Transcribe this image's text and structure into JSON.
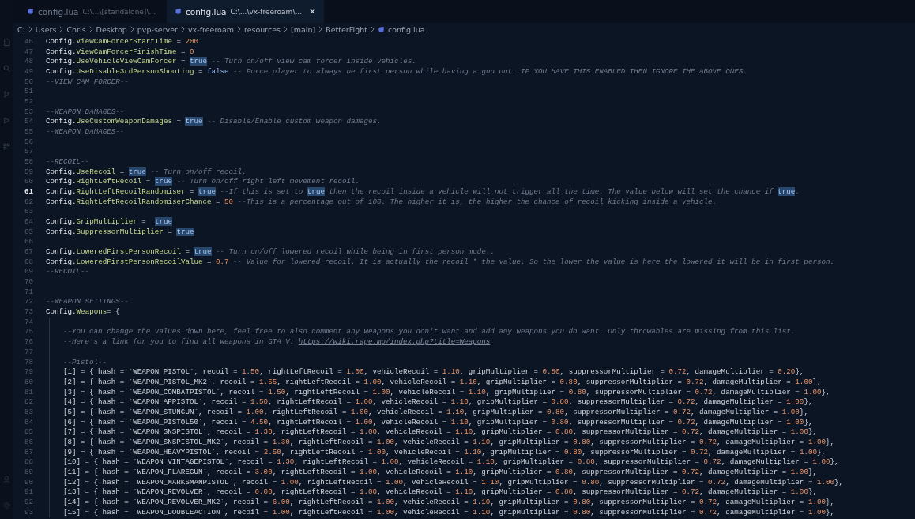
{
  "tabs": [
    {
      "name": "config.lua",
      "path": "C:\\...\\[standalone]\\...",
      "selected": false
    },
    {
      "name": "config.lua",
      "path": "C:\\...\\vx-freeroam\\...",
      "selected": true
    }
  ],
  "breadcrumb": [
    "C:",
    "Users",
    "Chris",
    "Desktop",
    "pvp-server",
    "vx-freeroam",
    "resources",
    "[main]",
    "BetterFight",
    "config.lua"
  ],
  "lines": [
    {
      "number": "46",
      "active": false,
      "tokens": [
        {
          "kind": "kw",
          "text": "Config."
        },
        {
          "kind": "prop",
          "text": "ViewCamForcerStartTime"
        },
        {
          "kind": "op",
          "text": " = "
        },
        {
          "kind": "num",
          "text": "200"
        }
      ]
    },
    {
      "number": "47",
      "active": false,
      "tokens": [
        {
          "kind": "kw",
          "text": "Config."
        },
        {
          "kind": "prop",
          "text": "ViewCamForcerFinishTime"
        },
        {
          "kind": "op",
          "text": " = "
        },
        {
          "kind": "num",
          "text": "0"
        }
      ]
    },
    {
      "number": "48",
      "active": false,
      "tokens": [
        {
          "kind": "kw",
          "text": "Config."
        },
        {
          "kind": "prop",
          "text": "UseVehicleViewCamForcer"
        },
        {
          "kind": "op",
          "text": " = "
        },
        {
          "kind": "match",
          "text": "true"
        },
        {
          "kind": "comment",
          "text": " -- Turn on/off view cam forcer inside vehicles."
        }
      ]
    },
    {
      "number": "49",
      "active": false,
      "tokens": [
        {
          "kind": "kw",
          "text": "Config."
        },
        {
          "kind": "prop",
          "text": "UseDisable3rdPersonShooting"
        },
        {
          "kind": "op",
          "text": " = "
        },
        {
          "kind": "bool",
          "text": "false"
        },
        {
          "kind": "comment",
          "text": " -- Force player to always be first person while having a gun out. IF YOU HAVE THIS ENABLED THEN IGNORE THE ABOVE ONES."
        }
      ]
    },
    {
      "number": "50",
      "active": false,
      "tokens": [
        {
          "kind": "comment",
          "text": "--VIEW CAM FORCER--"
        }
      ]
    },
    {
      "number": "51",
      "active": false
    },
    {
      "number": "52",
      "active": false
    },
    {
      "number": "53",
      "active": false,
      "tokens": [
        {
          "kind": "comment",
          "text": "--WEAPON DAMAGES--"
        }
      ]
    },
    {
      "number": "54",
      "active": false,
      "tokens": [
        {
          "kind": "kw",
          "text": "Config."
        },
        {
          "kind": "prop",
          "text": "UseCustomWeaponDamages"
        },
        {
          "kind": "op",
          "text": " = "
        },
        {
          "kind": "match",
          "text": "true"
        },
        {
          "kind": "comment",
          "text": " -- Disable/Enable custom weapon damages."
        }
      ]
    },
    {
      "number": "55",
      "active": false,
      "tokens": [
        {
          "kind": "comment",
          "text": "--WEAPON DAMAGES--"
        }
      ]
    },
    {
      "number": "56",
      "active": false
    },
    {
      "number": "57",
      "active": false
    },
    {
      "number": "58",
      "active": false,
      "tokens": [
        {
          "kind": "comment",
          "text": "--RECOIL--"
        }
      ]
    },
    {
      "number": "59",
      "active": false,
      "tokens": [
        {
          "kind": "kw",
          "text": "Config."
        },
        {
          "kind": "prop",
          "text": "UseRecoil"
        },
        {
          "kind": "op",
          "text": " = "
        },
        {
          "kind": "match",
          "text": "true"
        },
        {
          "kind": "comment",
          "text": " -- Turn on/off recoil."
        }
      ]
    },
    {
      "number": "60",
      "active": false,
      "tokens": [
        {
          "kind": "kw",
          "text": "Config."
        },
        {
          "kind": "prop",
          "text": "RightLeftRecoil"
        },
        {
          "kind": "op",
          "text": " = "
        },
        {
          "kind": "match",
          "text": "true"
        },
        {
          "kind": "comment",
          "text": " -- Turn on/off right left movement recoil."
        }
      ]
    },
    {
      "number": "61",
      "active": true,
      "tokens": [
        {
          "kind": "kw",
          "text": "Config."
        },
        {
          "kind": "prop",
          "text": "RightLeftRecoilRandomiser"
        },
        {
          "kind": "op",
          "text": " = "
        },
        {
          "kind": "match",
          "text": "true"
        },
        {
          "kind": "comment",
          "text": " --If this is set to "
        },
        {
          "kind": "match",
          "text": "true"
        },
        {
          "kind": "comment",
          "text": " then the recoil inside a vehicle will not trigger all the time. The value below will set the chance if "
        },
        {
          "kind": "match",
          "text": "true"
        },
        {
          "kind": "comment",
          "text": "."
        }
      ]
    },
    {
      "number": "62",
      "active": false,
      "tokens": [
        {
          "kind": "kw",
          "text": "Config."
        },
        {
          "kind": "prop",
          "text": "RightLeftRecoilRandomiserChance"
        },
        {
          "kind": "op",
          "text": " = "
        },
        {
          "kind": "num",
          "text": "50"
        },
        {
          "kind": "comment",
          "text": " --This is a percentage out of 100. The higher it is, the higher the chance of recoil kicking inside a vehicle."
        }
      ]
    },
    {
      "number": "63",
      "active": false
    },
    {
      "number": "64",
      "active": false,
      "tokens": [
        {
          "kind": "kw",
          "text": "Config."
        },
        {
          "kind": "prop",
          "text": "GripMultiplier"
        },
        {
          "kind": "op",
          "text": " =  "
        },
        {
          "kind": "match",
          "text": "true"
        }
      ]
    },
    {
      "number": "65",
      "active": false,
      "tokens": [
        {
          "kind": "kw",
          "text": "Config."
        },
        {
          "kind": "prop",
          "text": "SuppressorMultiplier"
        },
        {
          "kind": "op",
          "text": " = "
        },
        {
          "kind": "match",
          "text": "true"
        }
      ]
    },
    {
      "number": "66",
      "active": false
    },
    {
      "number": "67",
      "active": false,
      "tokens": [
        {
          "kind": "kw",
          "text": "Config."
        },
        {
          "kind": "prop",
          "text": "LoweredFirstPersonRecoil"
        },
        {
          "kind": "op",
          "text": " = "
        },
        {
          "kind": "match",
          "text": "true"
        },
        {
          "kind": "comment",
          "text": " -- Turn on/off lowered recoil while being in first person mode.."
        }
      ]
    },
    {
      "number": "68",
      "active": false,
      "tokens": [
        {
          "kind": "kw",
          "text": "Config."
        },
        {
          "kind": "prop",
          "text": "LoweredFirstPersonRecoilValue"
        },
        {
          "kind": "op",
          "text": " = "
        },
        {
          "kind": "num",
          "text": "0.7"
        },
        {
          "kind": "comment",
          "text": " -- Value for lowered recoil. It is actually the recoil * the value. So the lower the value is here the lowered it will be in first person."
        }
      ]
    },
    {
      "number": "69",
      "active": false,
      "tokens": [
        {
          "kind": "comment",
          "text": "--RECOIL--"
        }
      ]
    },
    {
      "number": "70",
      "active": false
    },
    {
      "number": "71",
      "active": false
    },
    {
      "number": "72",
      "active": false,
      "tokens": [
        {
          "kind": "comment",
          "text": "--WEAPON SETTINGS--"
        }
      ]
    },
    {
      "number": "73",
      "active": false,
      "tokens": [
        {
          "kind": "kw",
          "text": "Config."
        },
        {
          "kind": "prop",
          "text": "Weapons"
        },
        {
          "kind": "op",
          "text": "= {"
        }
      ],
      "children": [
        {
          "number": "74",
          "active": false
        },
        {
          "number": "75",
          "active": false,
          "tokens": [
            {
              "kind": "comment",
              "text": "--You can change the values down here, feel free to also comment any weapons you don't want and add any weapons you do want. Only throwables are missing from this list."
            }
          ]
        },
        {
          "number": "76",
          "active": false,
          "tokens": [
            {
              "kind": "comment",
              "text": "--Here's a link for you to find all weapons in GTA V: "
            },
            {
              "kind": "link",
              "text": "https://wiki.rage.mp/index.php?title=Weapons"
            }
          ]
        },
        {
          "number": "77",
          "active": false
        },
        {
          "number": "78",
          "active": false,
          "tokens": [
            {
              "kind": "comment",
              "text": "--Pistol--"
            }
          ]
        },
        {
          "number": "79",
          "active": false,
          "tokens": [
            {
              "kind": "op",
              "text": "[1] = { hash = `WEAPON_PISTOL`, recoil = "
            },
            {
              "kind": "num",
              "text": "1.50"
            },
            {
              "kind": "op",
              "text": ", rightLeftRecoil = "
            },
            {
              "kind": "num",
              "text": "1.00"
            },
            {
              "kind": "op",
              "text": ", vehicleRecoil = "
            },
            {
              "kind": "num",
              "text": "1.10"
            },
            {
              "kind": "op",
              "text": ", gripMultiplier = "
            },
            {
              "kind": "num",
              "text": "0.80"
            },
            {
              "kind": "op",
              "text": ", suppressorMultiplier = "
            },
            {
              "kind": "num",
              "text": "0.72"
            },
            {
              "kind": "op",
              "text": ", damageMultiplier = "
            },
            {
              "kind": "num",
              "text": "0.20"
            },
            {
              "kind": "op",
              "text": "},"
            }
          ]
        },
        {
          "number": "80",
          "active": false,
          "tokens": [
            {
              "kind": "op",
              "text": "[2] = { hash = `WEAPON_PISTOL_MK2`, recoil = "
            },
            {
              "kind": "num",
              "text": "1.55"
            },
            {
              "kind": "op",
              "text": ", rightLeftRecoil = "
            },
            {
              "kind": "num",
              "text": "1.00"
            },
            {
              "kind": "op",
              "text": ", vehicleRecoil = "
            },
            {
              "kind": "num",
              "text": "1.10"
            },
            {
              "kind": "op",
              "text": ", gripMultiplier = "
            },
            {
              "kind": "num",
              "text": "0.80"
            },
            {
              "kind": "op",
              "text": ", suppressorMultiplier = "
            },
            {
              "kind": "num",
              "text": "0.72"
            },
            {
              "kind": "op",
              "text": ", damageMultiplier = "
            },
            {
              "kind": "num",
              "text": "1.00"
            },
            {
              "kind": "op",
              "text": "},"
            }
          ]
        },
        {
          "number": "81",
          "active": false,
          "tokens": [
            {
              "kind": "op",
              "text": "[3] = { hash = `WEAPON_COMBATPISTOL`, recoil = "
            },
            {
              "kind": "num",
              "text": "1.50"
            },
            {
              "kind": "op",
              "text": ", rightLeftRecoil = "
            },
            {
              "kind": "num",
              "text": "1.00"
            },
            {
              "kind": "op",
              "text": ", vehicleRecoil = "
            },
            {
              "kind": "num",
              "text": "1.10"
            },
            {
              "kind": "op",
              "text": ", gripMultiplier = "
            },
            {
              "kind": "num",
              "text": "0.80"
            },
            {
              "kind": "op",
              "text": ", suppressorMultiplier = "
            },
            {
              "kind": "num",
              "text": "0.72"
            },
            {
              "kind": "op",
              "text": ", damageMultiplier = "
            },
            {
              "kind": "num",
              "text": "1.00"
            },
            {
              "kind": "op",
              "text": "},"
            }
          ]
        },
        {
          "number": "82",
          "active": false,
          "tokens": [
            {
              "kind": "op",
              "text": "[4] = { hash = `WEAPON_APPISTOL`, recoil = "
            },
            {
              "kind": "num",
              "text": "1.50"
            },
            {
              "kind": "op",
              "text": ", rightLeftRecoil = "
            },
            {
              "kind": "num",
              "text": "1.00"
            },
            {
              "kind": "op",
              "text": ", vehicleRecoil = "
            },
            {
              "kind": "num",
              "text": "1.10"
            },
            {
              "kind": "op",
              "text": ", gripMultiplier = "
            },
            {
              "kind": "num",
              "text": "0.80"
            },
            {
              "kind": "op",
              "text": ", suppressorMultiplier = "
            },
            {
              "kind": "num",
              "text": "0.72"
            },
            {
              "kind": "op",
              "text": ", damageMultiplier = "
            },
            {
              "kind": "num",
              "text": "1.00"
            },
            {
              "kind": "op",
              "text": "},"
            }
          ]
        },
        {
          "number": "83",
          "active": false,
          "tokens": [
            {
              "kind": "op",
              "text": "[5] = { hash = `WEAPON_STUNGUN`, recoil = "
            },
            {
              "kind": "num",
              "text": "1.00"
            },
            {
              "kind": "op",
              "text": ", rightLeftRecoil = "
            },
            {
              "kind": "num",
              "text": "1.00"
            },
            {
              "kind": "op",
              "text": ", vehicleRecoil = "
            },
            {
              "kind": "num",
              "text": "1.10"
            },
            {
              "kind": "op",
              "text": ", gripMultiplier = "
            },
            {
              "kind": "num",
              "text": "0.80"
            },
            {
              "kind": "op",
              "text": ", suppressorMultiplier = "
            },
            {
              "kind": "num",
              "text": "0.72"
            },
            {
              "kind": "op",
              "text": ", damageMultiplier = "
            },
            {
              "kind": "num",
              "text": "1.00"
            },
            {
              "kind": "op",
              "text": "},"
            }
          ]
        },
        {
          "number": "84",
          "active": false,
          "tokens": [
            {
              "kind": "op",
              "text": "[6] = { hash = `WEAPON_PISTOL50`, recoil = "
            },
            {
              "kind": "num",
              "text": "4.50"
            },
            {
              "kind": "op",
              "text": ", rightLeftRecoil = "
            },
            {
              "kind": "num",
              "text": "1.00"
            },
            {
              "kind": "op",
              "text": ", vehicleRecoil = "
            },
            {
              "kind": "num",
              "text": "1.10"
            },
            {
              "kind": "op",
              "text": ", gripMultiplier = "
            },
            {
              "kind": "num",
              "text": "0.80"
            },
            {
              "kind": "op",
              "text": ", suppressorMultiplier = "
            },
            {
              "kind": "num",
              "text": "0.72"
            },
            {
              "kind": "op",
              "text": ", damageMultiplier = "
            },
            {
              "kind": "num",
              "text": "1.00"
            },
            {
              "kind": "op",
              "text": "},"
            }
          ]
        },
        {
          "number": "85",
          "active": false,
          "tokens": [
            {
              "kind": "op",
              "text": "[7] = { hash = `WEAPON_SNSPISTOL`, recoil = "
            },
            {
              "kind": "num",
              "text": "1.30"
            },
            {
              "kind": "op",
              "text": ", rightLeftRecoil = "
            },
            {
              "kind": "num",
              "text": "1.00"
            },
            {
              "kind": "op",
              "text": ", vehicleRecoil = "
            },
            {
              "kind": "num",
              "text": "1.10"
            },
            {
              "kind": "op",
              "text": ", gripMultiplier = "
            },
            {
              "kind": "num",
              "text": "0.80"
            },
            {
              "kind": "op",
              "text": ", suppressorMultiplier = "
            },
            {
              "kind": "num",
              "text": "0.72"
            },
            {
              "kind": "op",
              "text": ", damageMultiplier = "
            },
            {
              "kind": "num",
              "text": "1.00"
            },
            {
              "kind": "op",
              "text": "},"
            }
          ]
        },
        {
          "number": "86",
          "active": false,
          "tokens": [
            {
              "kind": "op",
              "text": "[8] = { hash = `WEAPON_SNSPISTOL_MK2`, recoil = "
            },
            {
              "kind": "num",
              "text": "1.30"
            },
            {
              "kind": "op",
              "text": ", rightLeftRecoil = "
            },
            {
              "kind": "num",
              "text": "1.00"
            },
            {
              "kind": "op",
              "text": ", vehicleRecoil = "
            },
            {
              "kind": "num",
              "text": "1.10"
            },
            {
              "kind": "op",
              "text": ", gripMultiplier = "
            },
            {
              "kind": "num",
              "text": "0.80"
            },
            {
              "kind": "op",
              "text": ", suppressorMultiplier = "
            },
            {
              "kind": "num",
              "text": "0.72"
            },
            {
              "kind": "op",
              "text": ", damageMultiplier = "
            },
            {
              "kind": "num",
              "text": "1.00"
            },
            {
              "kind": "op",
              "text": "},"
            }
          ]
        },
        {
          "number": "87",
          "active": false,
          "tokens": [
            {
              "kind": "op",
              "text": "[9] = { hash = `WEAPON_HEAVYPISTOL`, recoil = "
            },
            {
              "kind": "num",
              "text": "2.50"
            },
            {
              "kind": "op",
              "text": ", rightLeftRecoil = "
            },
            {
              "kind": "num",
              "text": "1.00"
            },
            {
              "kind": "op",
              "text": ", vehicleRecoil = "
            },
            {
              "kind": "num",
              "text": "1.10"
            },
            {
              "kind": "op",
              "text": ", gripMultiplier = "
            },
            {
              "kind": "num",
              "text": "0.80"
            },
            {
              "kind": "op",
              "text": ", suppressorMultiplier = "
            },
            {
              "kind": "num",
              "text": "0.72"
            },
            {
              "kind": "op",
              "text": ", damageMultiplier = "
            },
            {
              "kind": "num",
              "text": "1.00"
            },
            {
              "kind": "op",
              "text": "},"
            }
          ]
        },
        {
          "number": "88",
          "active": false,
          "tokens": [
            {
              "kind": "op",
              "text": "[10] = { hash = `WEAPON_VINTAGEPISTOL`, recoil = "
            },
            {
              "kind": "num",
              "text": "1.30"
            },
            {
              "kind": "op",
              "text": ", rightLeftRecoil = "
            },
            {
              "kind": "num",
              "text": "1.00"
            },
            {
              "kind": "op",
              "text": ", vehicleRecoil = "
            },
            {
              "kind": "num",
              "text": "1.10"
            },
            {
              "kind": "op",
              "text": ", gripMultiplier = "
            },
            {
              "kind": "num",
              "text": "0.80"
            },
            {
              "kind": "op",
              "text": ", suppressorMultiplier = "
            },
            {
              "kind": "num",
              "text": "0.72"
            },
            {
              "kind": "op",
              "text": ", damageMultiplier = "
            },
            {
              "kind": "num",
              "text": "1.00"
            },
            {
              "kind": "op",
              "text": "},"
            }
          ]
        },
        {
          "number": "89",
          "active": false,
          "tokens": [
            {
              "kind": "op",
              "text": "[11] = { hash = `WEAPON_FLAREGUN`, recoil = "
            },
            {
              "kind": "num",
              "text": "3.00"
            },
            {
              "kind": "op",
              "text": ", rightLeftRecoil = "
            },
            {
              "kind": "num",
              "text": "1.00"
            },
            {
              "kind": "op",
              "text": ", vehicleRecoil = "
            },
            {
              "kind": "num",
              "text": "1.10"
            },
            {
              "kind": "op",
              "text": ", gripMultiplier = "
            },
            {
              "kind": "num",
              "text": "0.80"
            },
            {
              "kind": "op",
              "text": ", suppressorMultiplier = "
            },
            {
              "kind": "num",
              "text": "0.72"
            },
            {
              "kind": "op",
              "text": ", damageMultiplier = "
            },
            {
              "kind": "num",
              "text": "1.00"
            },
            {
              "kind": "op",
              "text": "},"
            }
          ]
        },
        {
          "number": "90",
          "active": false,
          "tokens": [
            {
              "kind": "op",
              "text": "[12] = { hash = `WEAPON_MARKSMANPISTOL`, recoil = "
            },
            {
              "kind": "num",
              "text": "1.00"
            },
            {
              "kind": "op",
              "text": ", rightLeftRecoil = "
            },
            {
              "kind": "num",
              "text": "1.00"
            },
            {
              "kind": "op",
              "text": ", vehicleRecoil = "
            },
            {
              "kind": "num",
              "text": "1.10"
            },
            {
              "kind": "op",
              "text": ", gripMultiplier = "
            },
            {
              "kind": "num",
              "text": "0.80"
            },
            {
              "kind": "op",
              "text": ", suppressorMultiplier = "
            },
            {
              "kind": "num",
              "text": "0.72"
            },
            {
              "kind": "op",
              "text": ", damageMultiplier = "
            },
            {
              "kind": "num",
              "text": "1.00"
            },
            {
              "kind": "op",
              "text": "},"
            }
          ]
        },
        {
          "number": "91",
          "active": false,
          "tokens": [
            {
              "kind": "op",
              "text": "[13] = { hash = `WEAPON_REVOLVER`, recoil = "
            },
            {
              "kind": "num",
              "text": "6.00"
            },
            {
              "kind": "op",
              "text": ", rightLeftRecoil = "
            },
            {
              "kind": "num",
              "text": "1.00"
            },
            {
              "kind": "op",
              "text": ", vehicleRecoil = "
            },
            {
              "kind": "num",
              "text": "1.10"
            },
            {
              "kind": "op",
              "text": ", gripMultiplier = "
            },
            {
              "kind": "num",
              "text": "0.80"
            },
            {
              "kind": "op",
              "text": ", suppressorMultiplier = "
            },
            {
              "kind": "num",
              "text": "0.72"
            },
            {
              "kind": "op",
              "text": ", damageMultiplier = "
            },
            {
              "kind": "num",
              "text": "1.00"
            },
            {
              "kind": "op",
              "text": "},"
            }
          ]
        },
        {
          "number": "92",
          "active": false,
          "tokens": [
            {
              "kind": "op",
              "text": "[14] = { hash = `WEAPON_REVOLVER_MK2`, recoil = "
            },
            {
              "kind": "num",
              "text": "6.00"
            },
            {
              "kind": "op",
              "text": ", rightLeftRecoil = "
            },
            {
              "kind": "num",
              "text": "1.00"
            },
            {
              "kind": "op",
              "text": ", vehicleRecoil = "
            },
            {
              "kind": "num",
              "text": "1.10"
            },
            {
              "kind": "op",
              "text": ", gripMultiplier = "
            },
            {
              "kind": "num",
              "text": "0.80"
            },
            {
              "kind": "op",
              "text": ", suppressorMultiplier = "
            },
            {
              "kind": "num",
              "text": "0.72"
            },
            {
              "kind": "op",
              "text": ", damageMultiplier = "
            },
            {
              "kind": "num",
              "text": "1.00"
            },
            {
              "kind": "op",
              "text": "},"
            }
          ]
        },
        {
          "number": "93",
          "active": false,
          "tokens": [
            {
              "kind": "op",
              "text": "[15] = { hash = `WEAPON_DOUBLEACTION`, recoil = "
            },
            {
              "kind": "num",
              "text": "1.00"
            },
            {
              "kind": "op",
              "text": ", rightLeftRecoil = "
            },
            {
              "kind": "num",
              "text": "1.00"
            },
            {
              "kind": "op",
              "text": ", vehicleRecoil = "
            },
            {
              "kind": "num",
              "text": "1.10"
            },
            {
              "kind": "op",
              "text": ", gripMultiplier = "
            },
            {
              "kind": "num",
              "text": "0.80"
            },
            {
              "kind": "op",
              "text": ", suppressorMultiplier = "
            },
            {
              "kind": "num",
              "text": "0.72"
            },
            {
              "kind": "op",
              "text": ", damageMultiplier = "
            },
            {
              "kind": "num",
              "text": "1.00"
            },
            {
              "kind": "op",
              "text": "},"
            }
          ]
        }
      ]
    }
  ]
}
